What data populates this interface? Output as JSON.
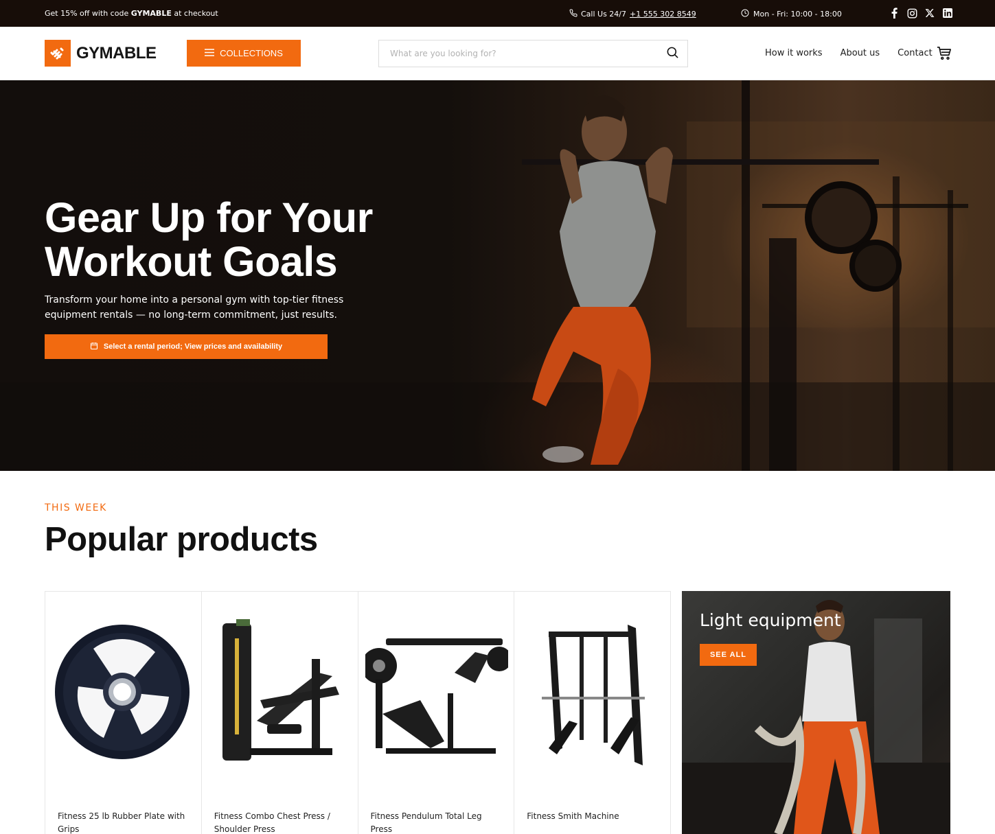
{
  "topbar": {
    "promo_prefix": "Get 15% off with code ",
    "promo_code": "GYMABLE",
    "promo_suffix": " at checkout",
    "call_label": "Call Us 24/7 ",
    "phone": "+1 555 302 8549",
    "hours": "Mon - Fri: 10:00 - 18:00",
    "social": [
      "facebook-icon",
      "instagram-icon",
      "x-icon",
      "linkedin-icon"
    ]
  },
  "header": {
    "logo_text": "GYMABLE",
    "collections_label": "COLLECTIONS",
    "search_placeholder": "What are you looking for?",
    "nav": [
      "How it works",
      "About us",
      "Contact"
    ]
  },
  "hero": {
    "title_line1": "Gear Up for Your",
    "title_line2": "Workout Goals",
    "subtitle": "Transform your home into a personal gym with top-tier fitness equipment rentals — no long-term commitment, just results.",
    "cta_label": "Select a rental period; View prices and availability"
  },
  "section": {
    "eyebrow": "THIS WEEK",
    "title": "Popular products"
  },
  "products": [
    {
      "name": "Fitness 25 lb Rubber Plate with Grips"
    },
    {
      "name": "Fitness Combo Chest Press / Shoulder Press"
    },
    {
      "name": "Fitness Pendulum Total Leg Press"
    },
    {
      "name": "Fitness Smith Machine"
    }
  ],
  "promo_tile": {
    "title": "Light equipment",
    "button": "SEE ALL"
  },
  "colors": {
    "accent": "#f26a10",
    "topbar_bg": "#170d08",
    "hero_bg": "#140f0c"
  }
}
